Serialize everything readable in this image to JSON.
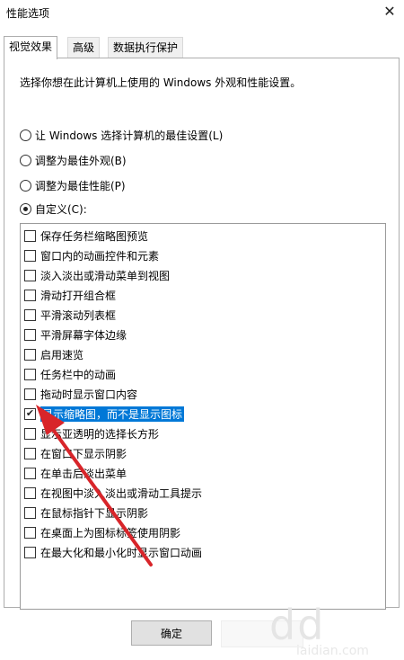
{
  "window": {
    "title": "性能选项",
    "close_glyph": "✕"
  },
  "tabs": [
    {
      "label": "视觉效果",
      "active": true
    },
    {
      "label": "高级",
      "active": false
    },
    {
      "label": "数据执行保护",
      "active": false
    }
  ],
  "description": "选择你想在此计算机上使用的 Windows 外观和性能设置。",
  "radio_options": [
    {
      "label": "让 Windows 选择计算机的最佳设置(L)",
      "selected": false
    },
    {
      "label": "调整为最佳外观(B)",
      "selected": false
    },
    {
      "label": "调整为最佳性能(P)",
      "selected": false
    },
    {
      "label": "自定义(C):",
      "selected": true
    }
  ],
  "effects": [
    {
      "label": "保存任务栏缩略图预览",
      "checked": false
    },
    {
      "label": "窗口内的动画控件和元素",
      "checked": false
    },
    {
      "label": "淡入淡出或滑动菜单到视图",
      "checked": false
    },
    {
      "label": "滑动打开组合框",
      "checked": false
    },
    {
      "label": "平滑滚动列表框",
      "checked": false
    },
    {
      "label": "平滑屏幕字体边缘",
      "checked": false
    },
    {
      "label": "启用速览",
      "checked": false
    },
    {
      "label": "任务栏中的动画",
      "checked": false
    },
    {
      "label": "拖动时显示窗口内容",
      "checked": false
    },
    {
      "label": "显示缩略图，而不是显示图标",
      "checked": true,
      "selected": true
    },
    {
      "label": "显示亚透明的选择长方形",
      "checked": false
    },
    {
      "label": "在窗口下显示阴影",
      "checked": false
    },
    {
      "label": "在单击后淡出菜单",
      "checked": false
    },
    {
      "label": "在视图中淡入淡出或滑动工具提示",
      "checked": false
    },
    {
      "label": "在鼠标指针下显示阴影",
      "checked": false
    },
    {
      "label": "在桌面上为图标标签使用阴影",
      "checked": false
    },
    {
      "label": "在最大化和最小化时显示窗口动画",
      "checked": false
    }
  ],
  "buttons": {
    "ok": "确定"
  },
  "watermark": {
    "text": "dd",
    "subtext": "iaidian.com"
  },
  "colors": {
    "selection": "#0078d7",
    "arrow": "#d8252a"
  }
}
